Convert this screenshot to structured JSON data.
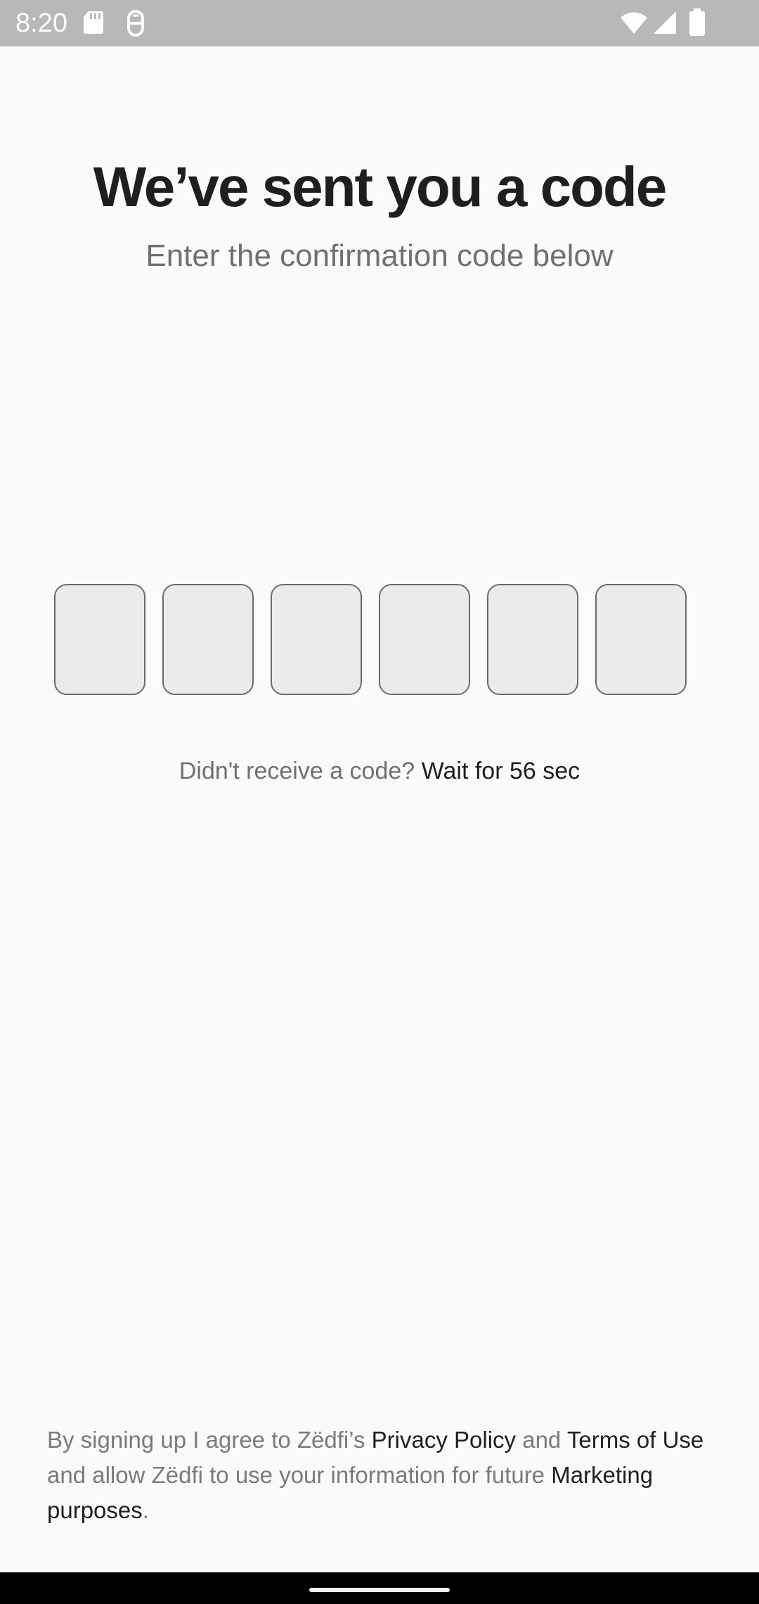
{
  "status_bar": {
    "time": "8:20",
    "icons": [
      "sd-card-icon",
      "recorder-icon",
      "wifi-icon",
      "signal-icon",
      "battery-icon"
    ]
  },
  "header": {
    "title": "We’ve sent you a code",
    "subtitle": "Enter the confirmation code below"
  },
  "code": {
    "length": 6,
    "digits": [
      "",
      "",
      "",
      "",
      "",
      ""
    ]
  },
  "resend": {
    "prompt": "Didn't receive a code?",
    "wait": "Wait for 56 sec"
  },
  "legal": {
    "part1": "By signing up I agree to Zëdfi’s ",
    "privacy_link": "Privacy Policy",
    "part2": " and ",
    "terms_link": "Terms of Use",
    "part3": " and allow Zëdfi to use your information for future ",
    "marketing_link": "Marketing purposes",
    "part4": "."
  },
  "colors": {
    "background": "#fafafa",
    "status_bar": "#b8b8b8",
    "title": "#1f1f1f",
    "muted_text": "#707070",
    "box_fill": "#ebebeb",
    "box_border": "#6b6b6b"
  }
}
